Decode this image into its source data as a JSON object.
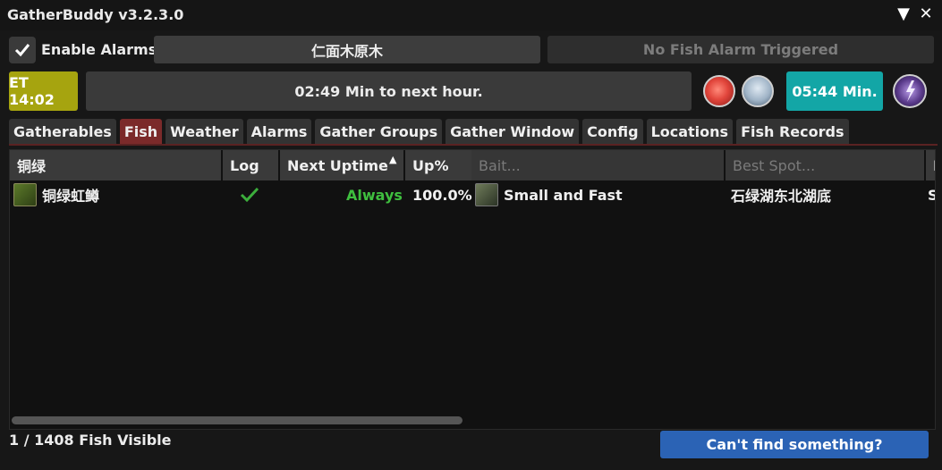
{
  "window": {
    "title": "GatherBuddy v3.2.3.0",
    "collapse_icon": "▼",
    "close_icon": "✕"
  },
  "toolbar": {
    "enable_alarms_label": "Enable Alarms",
    "enable_alarms_checked": true,
    "search_text": "仁面木原木",
    "alarm_status": "No Fish Alarm Triggered"
  },
  "time": {
    "eorzea_time": "ET 14:02",
    "next_hour": "02:49 Min to next hour.",
    "weather_timer": "05:44 Min.",
    "weather_icons": [
      "clear-sun-icon",
      "cloudy-icon",
      "thunderstorm-icon"
    ]
  },
  "tabs": [
    {
      "label": "Gatherables",
      "active": false
    },
    {
      "label": "Fish",
      "active": true
    },
    {
      "label": "Weather",
      "active": false
    },
    {
      "label": "Alarms",
      "active": false
    },
    {
      "label": "Gather Groups",
      "active": false
    },
    {
      "label": "Gather Window",
      "active": false
    },
    {
      "label": "Config",
      "active": false
    },
    {
      "label": "Locations",
      "active": false
    },
    {
      "label": "Fish Records",
      "active": false
    }
  ],
  "table": {
    "columns": {
      "name": "铜绿",
      "log": "Log",
      "next_uptime": "Next Uptime",
      "up_pct": "Up%",
      "bait": "Bait...",
      "best_spot": "Best Spot...",
      "more": "F"
    },
    "rows": [
      {
        "name": "铜绿虹鳟",
        "log_done": true,
        "next_uptime": "Always",
        "up_pct": "100.0%",
        "bait": "Small and Fast",
        "best_spot": "石绿湖东北湖底",
        "more": "S"
      }
    ]
  },
  "footer": {
    "count_text": "1 / 1408 Fish Visible",
    "help_button": "Can't find something?"
  },
  "colors": {
    "et_box": "#a6a40f",
    "timer_box": "#13a6a6",
    "active_tab": "#7b2a2a",
    "always_text": "#3fbf3f",
    "help_button": "#2b63b5"
  }
}
